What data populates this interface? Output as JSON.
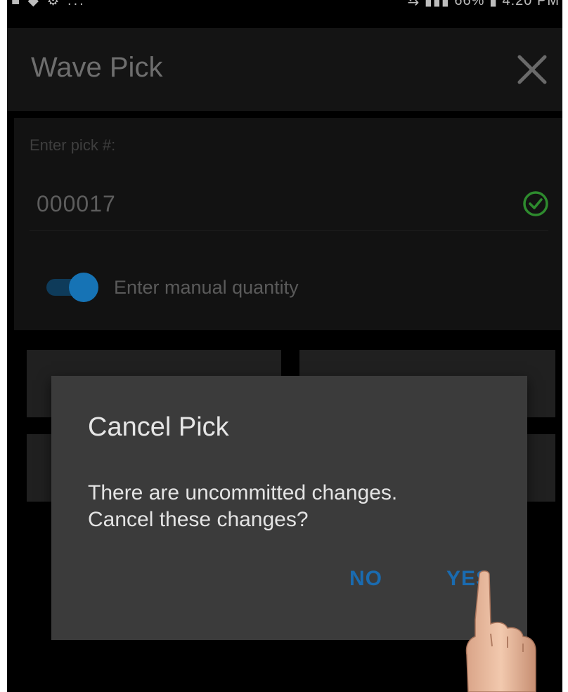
{
  "status_bar": {
    "left_icons": "■ ◆ ⚙ ...",
    "right_text": "⇆ ▮▮▮ 66% ▮ 4:20 PM"
  },
  "app_bar": {
    "title": "Wave Pick",
    "close_icon": "close-icon"
  },
  "form": {
    "pick_label": "Enter pick #:",
    "pick_value": "000017",
    "valid_icon": "check-circle-icon",
    "manual_quantity_toggle": {
      "label": "Enter manual quantity",
      "on": true
    }
  },
  "dialog": {
    "title": "Cancel Pick",
    "message_line1": "There are uncommitted changes.",
    "message_line2": "Cancel these changes?",
    "no_label": "NO",
    "yes_label": "YES"
  },
  "colors": {
    "accent_blue": "#1a6bb0",
    "check_green": "#2e8b2e",
    "dialog_bg": "#3b3b3b"
  }
}
